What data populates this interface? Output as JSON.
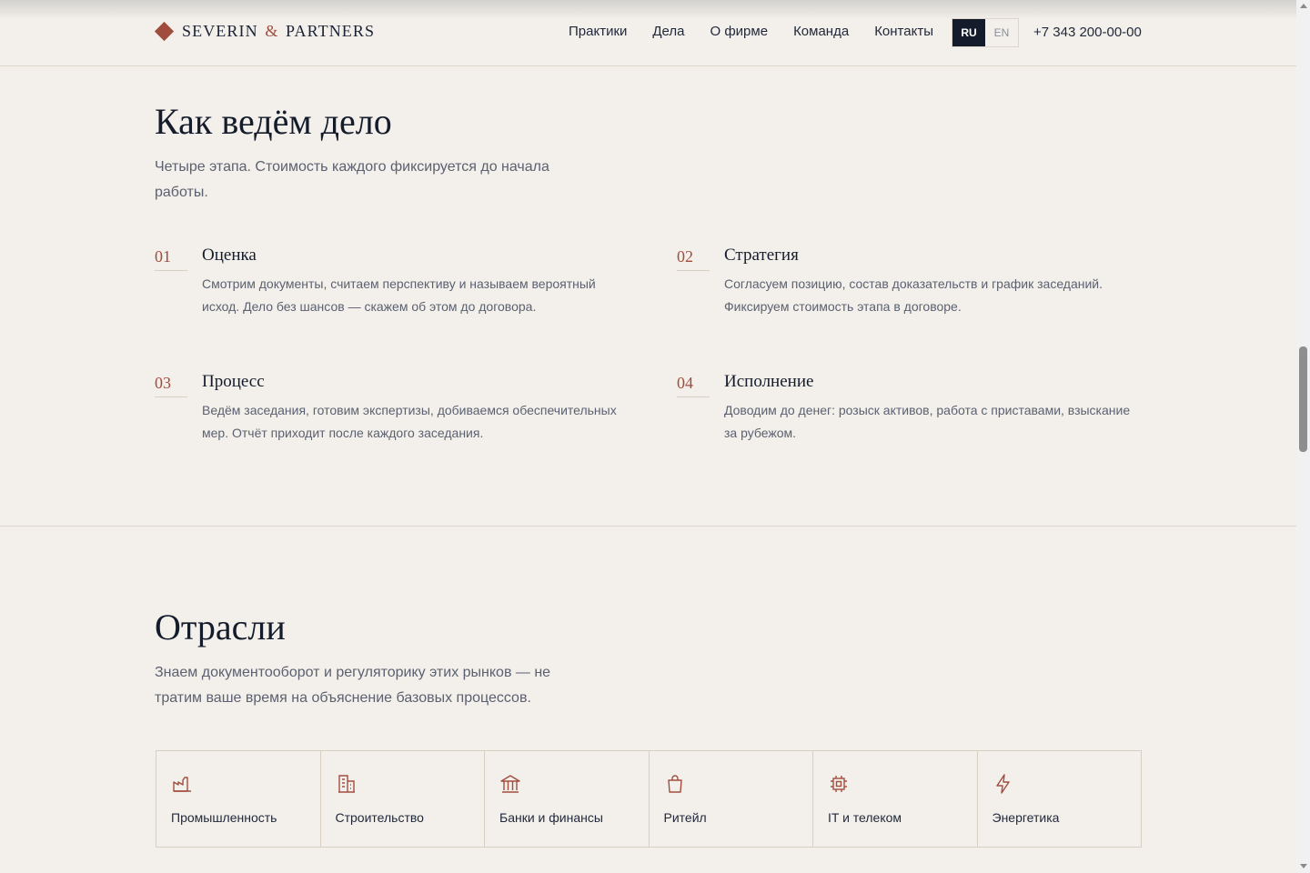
{
  "header": {
    "logo_left": "SEVERIN",
    "logo_amp": "&",
    "logo_right": "PARTNERS",
    "nav": [
      "Практики",
      "Дела",
      "О фирме",
      "Команда",
      "Контакты"
    ],
    "lang_active": "RU",
    "lang_inactive": "EN",
    "phone": "+7 343 200-00-00"
  },
  "process": {
    "title": "Как ведём дело",
    "lead": "Четыре этапа. Стоимость каждого фиксируется до начала работы.",
    "steps": [
      {
        "num": "01",
        "title": "Оценка",
        "desc": "Смотрим документы, считаем перспективу и называем вероятный исход. Дело без шансов — скажем об этом до договора."
      },
      {
        "num": "02",
        "title": "Стратегия",
        "desc": "Согласуем позицию, состав доказательств и график заседаний. Фиксируем стоимость этапа в договоре."
      },
      {
        "num": "03",
        "title": "Процесс",
        "desc": "Ведём заседания, готовим экспертизы, добиваемся обеспечительных мер. Отчёт приходит после каждого заседания."
      },
      {
        "num": "04",
        "title": "Исполнение",
        "desc": "Доводим до денег: розыск активов, работа с приставами, взыскание за рубежом."
      }
    ]
  },
  "industries": {
    "title": "Отрасли",
    "lead": "Знаем документооборот и регуляторику этих рынков — не тратим ваше время на объяснение базовых процессов.",
    "items": [
      {
        "label": "Промышленность",
        "icon": "factory-icon"
      },
      {
        "label": "Строительство",
        "icon": "building-icon"
      },
      {
        "label": "Банки и финансы",
        "icon": "bank-icon"
      },
      {
        "label": "Ритейл",
        "icon": "shopping-bag-icon"
      },
      {
        "label": "IT и телеком",
        "icon": "chip-icon"
      },
      {
        "label": "Энергетика",
        "icon": "lightning-icon"
      }
    ]
  },
  "colors": {
    "accent": "#a14d3e",
    "ink": "#141c2b",
    "background": "#f3f0eb",
    "muted": "#5b6170"
  }
}
